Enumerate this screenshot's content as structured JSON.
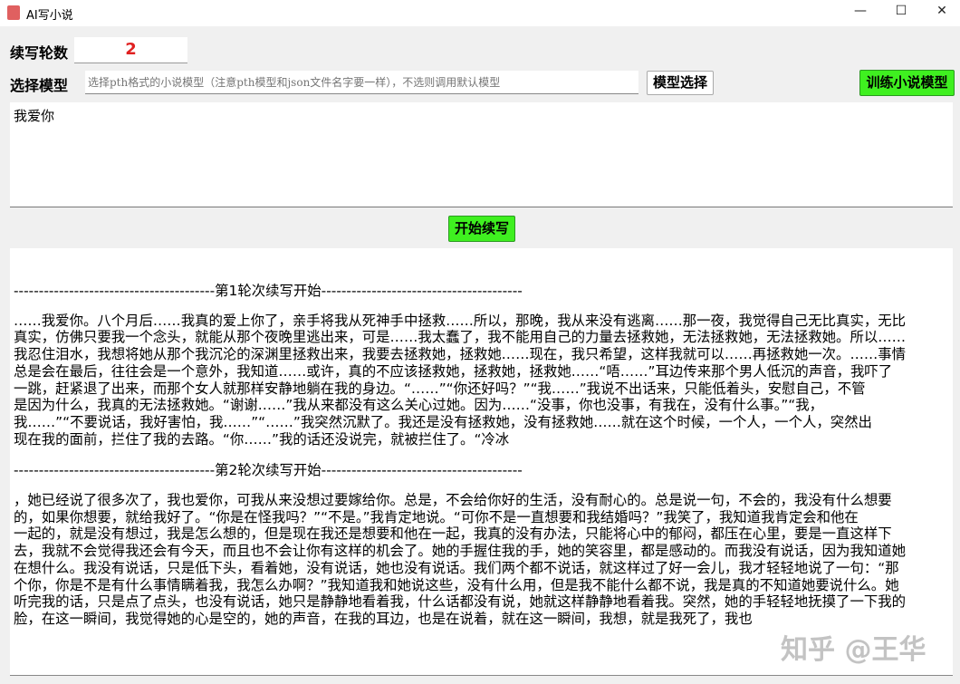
{
  "window": {
    "title": "AI写小说",
    "minimize": "—",
    "maximize": "☐",
    "close": "✕"
  },
  "controls": {
    "rounds_label": "续写轮数",
    "rounds_value": "2",
    "model_label": "选择模型",
    "model_placeholder": "选择pth格式的小说模型（注意pth模型和json文件名字要一样），不选则调用默认模型",
    "model_select_button": "模型选择",
    "train_button": "训练小说模型",
    "start_button": "开始续写"
  },
  "prompt": {
    "text": "我爱你"
  },
  "output": {
    "round1_header": "----------------------------------------第1轮次续写开始----------------------------------------",
    "round1_lines": [
      "……我爱你。八个月后……我真的爱上你了，亲手将我从死神手中拯救……所以，那晚，我从来没有逃离……那一夜，我觉得自己无比真实，无比",
      "真实，仿佛只要我一个念头，就能从那个夜晚里逃出来，可是……我太蠢了，我不能用自己的力量去拯救她，无法拯救她，无法拯救她。所以……",
      "我忍住泪水，我想将她从那个我沉沦的深渊里拯救出来，我要去拯救她，拯救她……现在，我只希望，这样我就可以……再拯救她一次。……事情",
      "总是会在最后，往往会是一个意外，我知道……或许，真的不应该拯救她，拯救她，拯救她……“唔……”耳边传来那个男人低沉的声音，我吓了",
      "一跳，赶紧退了出来，而那个女人就那样安静地躺在我的身边。“……”“你还好吗？”“我……”我说不出话来，只能低着头，安慰自己，不管",
      "是因为什么，我真的无法拯救她。“谢谢……”我从来都没有这么关心过她。因为……“没事，你也没事，有我在，没有什么事。”“我，",
      "我……”“不要说话，我好害怕，我……”“……”我突然沉默了。我还是没有拯救她，没有拯救她……就在这个时候，一个人，一个人，突然出",
      "现在我的面前，拦住了我的去路。“你……”我的话还没说完，就被拦住了。“冷冰"
    ],
    "round2_header": "----------------------------------------第2轮次续写开始----------------------------------------",
    "round2_lines": [
      "，她已经说了很多次了，我也爱你，可我从来没想过要嫁给你。总是，不会给你好的生活，没有耐心的。总是说一句，不会的，我没有什么想要",
      "的，如果你想要，就给我好了。“你是在怪我吗？”“不是。”我肯定地说。“可你不是一直想要和我结婚吗？”我笑了，我知道我肯定会和他在",
      "一起的，就是没有想过，我是怎么想的，但是现在我还是想要和他在一起，我真的没有办法，只能将心中的郁闷，都压在心里，要是一直这样下",
      "去，我就不会觉得我还会有今天，而且也不会让你有这样的机会了。她的手握住我的手，她的笑容里，都是感动的。而我没有说话，因为我知道她",
      "在想什么。我没有说话，只是低下头，看着她，没有说话，她也没有说话。我们两个都不说话，就这样过了好一会儿，我才轻轻地说了一句：“那",
      "个你，你是不是有什么事情瞒着我，我怎么办啊？”我知道我和她说这些，没有什么用，但是我不能什么都不说，我是真的不知道她要说什么。她",
      "听完我的话，只是点了点头，也没有说话，她只是静静地看着我，什么话都没有说，她就这样静静地看着我。突然，她的手轻轻地抚摸了一下我的",
      "脸，在这一瞬间，我觉得她的心是空的，她的声音，在我的耳边，也是在说着，就在这一瞬间，我想，就是我死了，我也"
    ]
  },
  "watermark": "知乎 @王华"
}
